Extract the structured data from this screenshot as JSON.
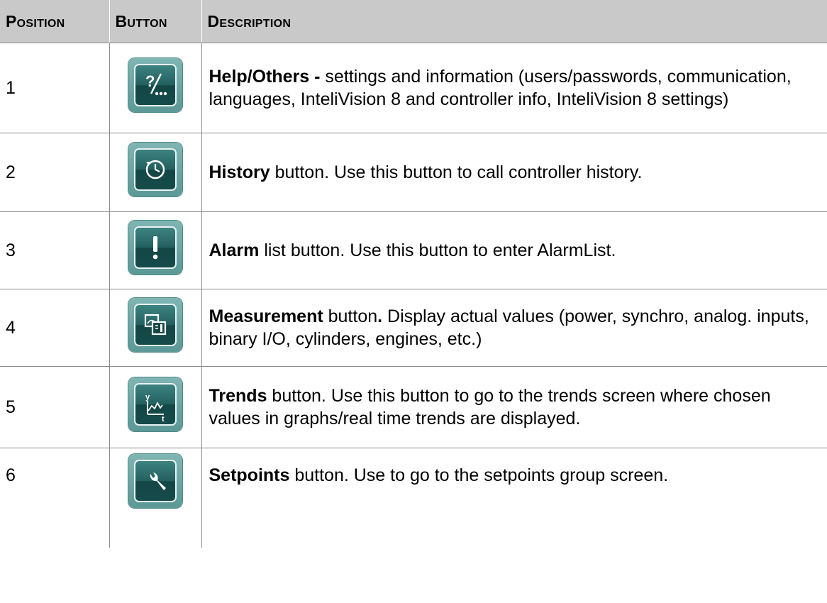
{
  "header": {
    "position": "Position",
    "button": "Button",
    "description": "Description"
  },
  "rows": [
    {
      "position": "1",
      "icon": "help-others-icon",
      "bold": "Help/Others -",
      "text": " settings and information (users/passwords, communication, languages, InteliVision 8 and controller info, InteliVision 8 settings)"
    },
    {
      "position": "2",
      "icon": "history-icon",
      "bold": "History",
      "text": " button. Use this button to call controller history."
    },
    {
      "position": "3",
      "icon": "alarm-icon",
      "bold": "Alarm",
      "text": " list button. Use this button to enter AlarmList."
    },
    {
      "position": "4",
      "icon": "measurement-icon",
      "bold": "Measurement",
      "text_a": " button",
      "bold_dot": ".",
      "text": " Display actual values (power, synchro, analog. inputs, binary I/O, cylinders, engines, etc.)"
    },
    {
      "position": "5",
      "icon": "trends-icon",
      "bold": "Trends",
      "text": " button. Use this button to go to the trends screen where chosen values in graphs/real time trends are displayed."
    },
    {
      "position": "6",
      "icon": "setpoints-wrench-icon",
      "bold": "Setpoints",
      "text": " button. Use to go to the setpoints group screen."
    }
  ],
  "colors": {
    "header_bg": "#c9c9c9",
    "button_teal": "#1e5c5b",
    "button_light": "#7fb5b3"
  }
}
